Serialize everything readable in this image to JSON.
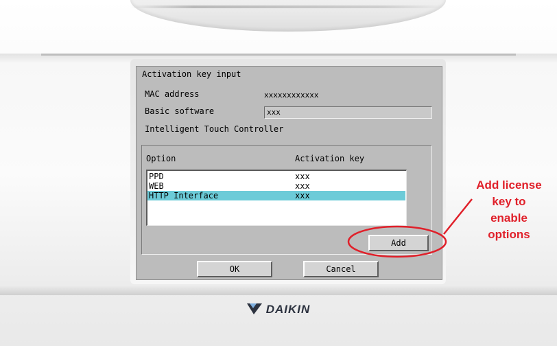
{
  "dialog": {
    "title": "Activation key input",
    "mac_label": "MAC address",
    "mac_value": "xxxxxxxxxxxx",
    "basic_label": "Basic software",
    "basic_value": "xxx",
    "controller_label": "Intelligent Touch Controller"
  },
  "options_table": {
    "headers": [
      "Option",
      "Activation key"
    ],
    "rows": [
      {
        "option": "PPD",
        "key": "xxx"
      },
      {
        "option": "WEB",
        "key": "xxx"
      },
      {
        "option": "HTTP Interface",
        "key": "xxx"
      }
    ],
    "selected_index": 2,
    "selected_color": "#6ccbd8"
  },
  "buttons": {
    "add": "Add",
    "ok": "OK",
    "cancel": "Cancel"
  },
  "annotation": {
    "lines": [
      "Add license",
      "key to",
      "enable",
      "options"
    ],
    "color": "#e0202a"
  },
  "brand": {
    "logo_text": "DAIKIN"
  }
}
